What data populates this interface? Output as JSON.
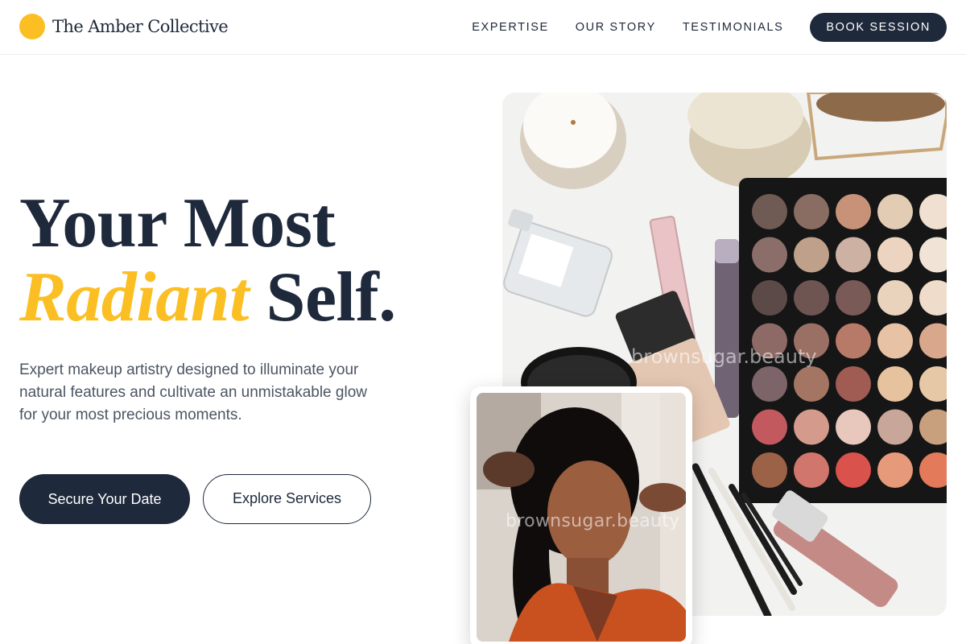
{
  "brand": {
    "name": "The Amber Collective",
    "accent_color": "#fbbf24",
    "dark_color": "#1e293b"
  },
  "nav": {
    "links": [
      "EXPERTISE",
      "OUR STORY",
      "TESTIMONIALS"
    ],
    "cta": "BOOK SESSION"
  },
  "hero": {
    "title_line1": "Your Most",
    "title_accent": "Radiant",
    "title_line2_rest": " Self.",
    "subtitle": "Expert makeup artistry designed to illuminate your natural features and cultivate an unmistakable glow for your most precious moments.",
    "primary_cta": "Secure Your Date",
    "secondary_cta": "Explore Services"
  },
  "images": {
    "main_watermark": "brownsugar.beauty",
    "inset_watermark": "brownsugar.beauty"
  }
}
